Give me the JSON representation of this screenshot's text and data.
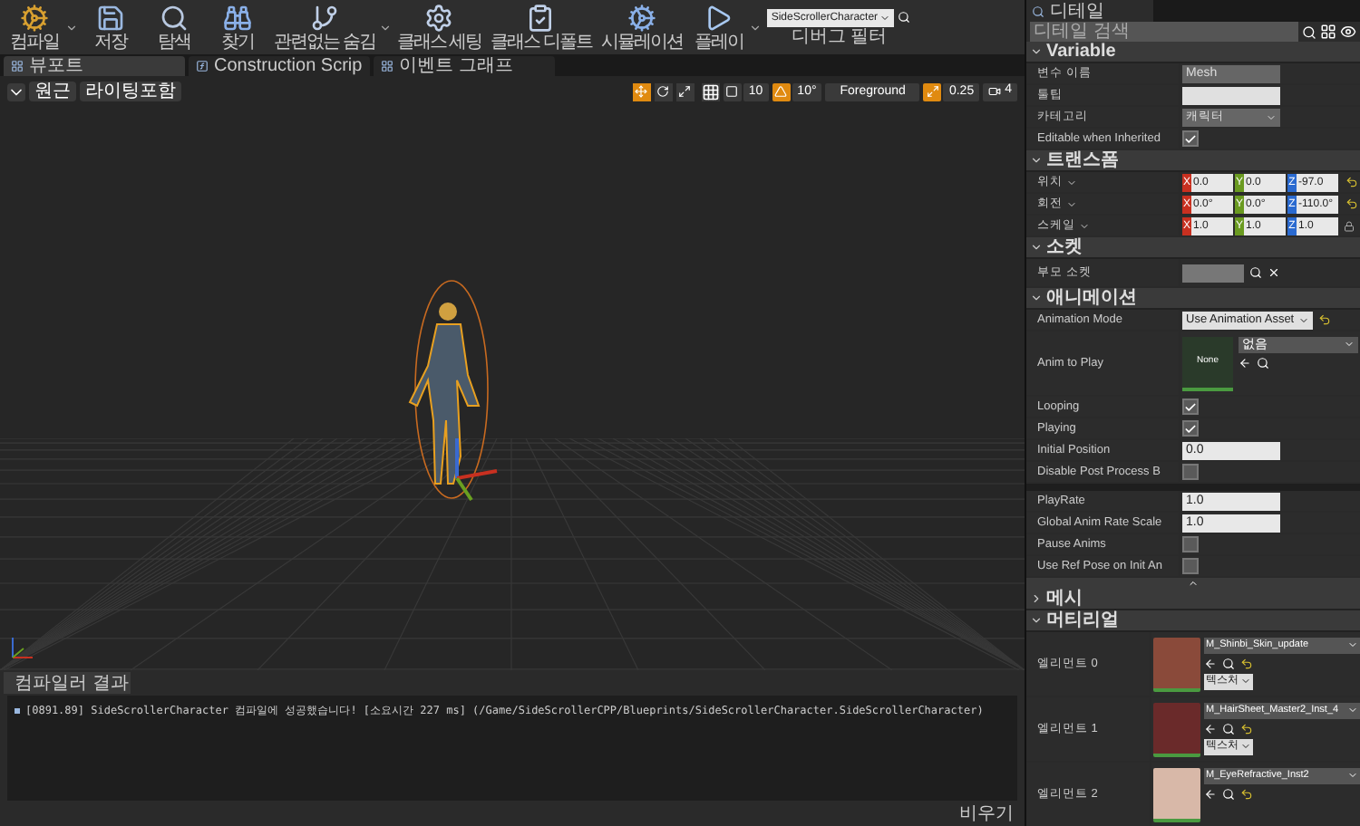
{
  "toolbar": {
    "buttons": [
      {
        "label": "컴파일",
        "kind": "compile",
        "dropdown": true
      },
      {
        "label": "저장",
        "kind": "save"
      },
      {
        "label": "탐색",
        "kind": "browse"
      },
      {
        "label": "찾기",
        "kind": "find"
      },
      {
        "label": "관련없는 숨김",
        "kind": "hide",
        "dropdown": true
      },
      {
        "label": "클래스 세팅",
        "kind": "class_settings"
      },
      {
        "label": "클래스 디폴트",
        "kind": "class_defaults"
      },
      {
        "label": "시뮬레이션",
        "kind": "simulate"
      },
      {
        "label": "플레이",
        "kind": "play",
        "dropdown": true
      }
    ],
    "debug_filter": {
      "value": "SideScrollerCharacter",
      "label": "디버그 필터"
    }
  },
  "editor_tabs": [
    {
      "label": "뷰포트",
      "kind": "viewport",
      "selected": true
    },
    {
      "label": "Construction Scrip",
      "kind": "function",
      "selected": false
    },
    {
      "label": "이벤트 그래프",
      "kind": "graph",
      "selected": false
    }
  ],
  "viewport_toolbar": {
    "view_mode": "원근",
    "lighting": "라이팅포함",
    "transform_tools": [
      {
        "kind": "move",
        "selected": true
      },
      {
        "kind": "rotate",
        "selected": false
      },
      {
        "kind": "scale",
        "selected": false
      }
    ],
    "grid_snap": {
      "on": false,
      "value": "10"
    },
    "rotation_snap": {
      "on": true,
      "value": "10°"
    },
    "layer": "Foreground",
    "scale_snap": {
      "on": true,
      "value": "0.25"
    },
    "camera_speed": "4"
  },
  "compiler_results": {
    "tab": "컴파일러 결과",
    "messages": [
      "[0891.89] SideScrollerCharacter 컴파일에 성공했습니다! [소요시간 227 ms] (/Game/SideScrollerCPP/Blueprints/SideScrollerCharacter.SideScrollerCharacter)"
    ],
    "clear_button": "비우기"
  },
  "details": {
    "tab": "디테일",
    "search": {
      "placeholder": "디테일 검색"
    },
    "sections": [
      {
        "title": "Variable",
        "expanded": true,
        "rows": [
          {
            "kind": "text",
            "label": "변수 이름",
            "value": "Mesh",
            "disabled": true
          },
          {
            "kind": "text",
            "label": "툴팁"
          },
          {
            "kind": "dropdown",
            "label": "카테고리",
            "value": "캐릭터",
            "disabled": true
          },
          {
            "kind": "checkbox",
            "label": "Editable when Inherited",
            "checked": true
          }
        ]
      },
      {
        "title": "트랜스폼",
        "expanded": true,
        "rows": [
          {
            "kind": "vector",
            "label": "위치",
            "values": [
              {
                "axis": "X",
                "value": "0.0"
              },
              {
                "axis": "Y",
                "value": "0.0"
              },
              {
                "axis": "Z",
                "value": "-97.0"
              }
            ],
            "reset": true
          },
          {
            "kind": "vector",
            "label": "회전",
            "values": [
              {
                "axis": "X",
                "value": "0.0°"
              },
              {
                "axis": "Y",
                "value": "0.0°"
              },
              {
                "axis": "Z",
                "value": "-110.0°"
              }
            ],
            "reset": true
          },
          {
            "kind": "vector",
            "label": "스케일",
            "values": [
              {
                "axis": "X",
                "value": "1.0"
              },
              {
                "axis": "Y",
                "value": "1.0"
              },
              {
                "axis": "Z",
                "value": "1.0"
              }
            ],
            "lock": true
          }
        ]
      },
      {
        "title": "소켓",
        "expanded": true,
        "rows": [
          {
            "kind": "socket",
            "label": "부모 소켓"
          }
        ]
      },
      {
        "title": "애니메이션",
        "expanded": true,
        "advanced": true,
        "rows": [
          {
            "kind": "dropdown",
            "label": "Animation Mode",
            "value": "Use Animation Asset",
            "reset": true
          },
          {
            "kind": "asset",
            "label": "Anim to Play",
            "thumbnail": "None",
            "value": "없음"
          },
          {
            "kind": "checkbox",
            "label": "Looping",
            "checked": true
          },
          {
            "kind": "checkbox",
            "label": "Playing",
            "checked": true
          },
          {
            "kind": "number",
            "label": "Initial Position",
            "value": "0.0"
          },
          {
            "kind": "checkbox",
            "label": "Disable Post Process B",
            "checked": false
          },
          {
            "kind": "divider"
          },
          {
            "kind": "number",
            "label": "PlayRate",
            "value": "1.0"
          },
          {
            "kind": "number",
            "label": "Global Anim Rate Scale",
            "value": "1.0"
          },
          {
            "kind": "checkbox",
            "label": "Pause Anims",
            "checked": false
          },
          {
            "kind": "checkbox",
            "label": "Use Ref Pose on Init An",
            "checked": false
          }
        ]
      },
      {
        "title": "메시",
        "expanded": false
      },
      {
        "title": "머티리얼",
        "expanded": true,
        "rows": [
          {
            "kind": "material",
            "label": "엘리먼트 0",
            "value": "M_Shinbi_Skin_update",
            "button": "텍스처",
            "color": "#8a4a3a"
          },
          {
            "kind": "material",
            "label": "엘리먼트 1",
            "value": "M_HairSheet_Master2_Inst_4",
            "button": "텍스처",
            "color": "#6a2a2a"
          },
          {
            "kind": "material",
            "label": "엘리먼트 2",
            "value": "M_EyeRefractive_Inst2",
            "color": "#d8b8a8"
          }
        ]
      }
    ]
  }
}
